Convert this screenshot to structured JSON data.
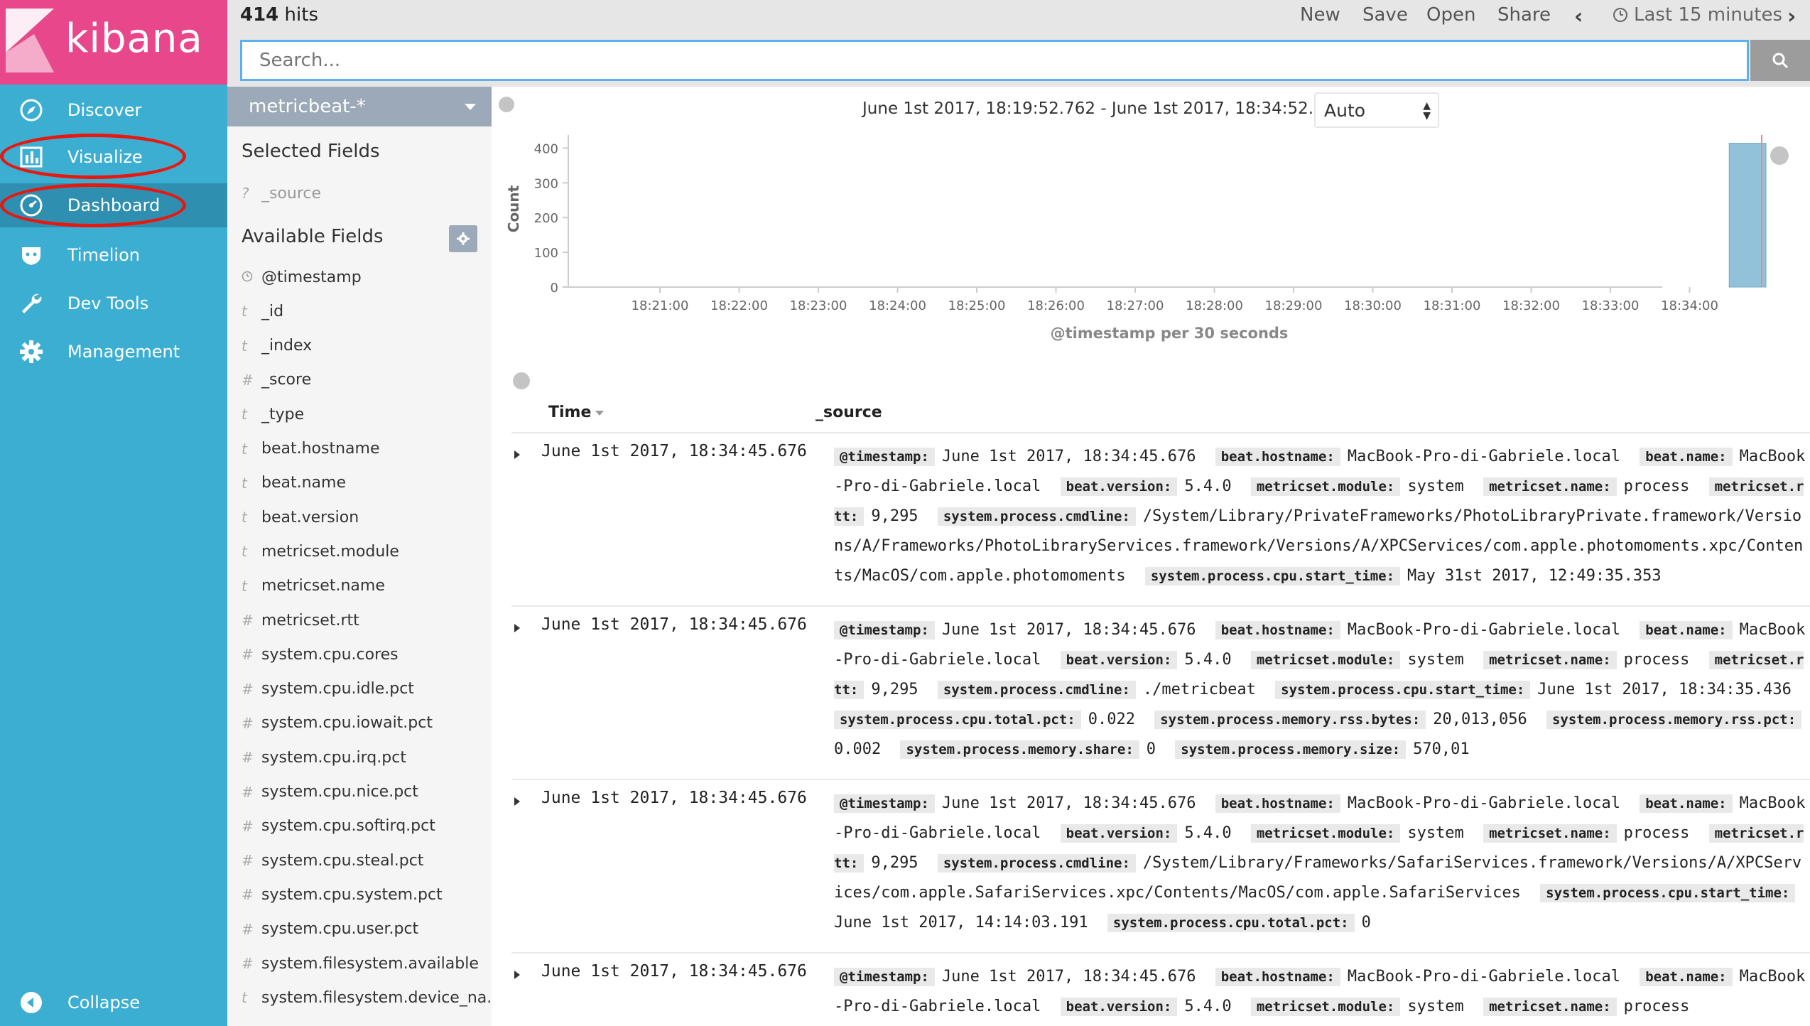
{
  "app": {
    "name": "kibana"
  },
  "nav": {
    "items": [
      {
        "label": "Discover",
        "icon": "compass-icon"
      },
      {
        "label": "Visualize",
        "icon": "bar-chart-icon"
      },
      {
        "label": "Dashboard",
        "icon": "dashboard-gauge-icon"
      },
      {
        "label": "Timelion",
        "icon": "timelion-shield-icon"
      },
      {
        "label": "Dev Tools",
        "icon": "wrench-icon"
      },
      {
        "label": "Management",
        "icon": "gear-icon"
      }
    ],
    "collapse_label": "Collapse"
  },
  "topbar": {
    "hits_count": "414",
    "hits_label": "hits",
    "new_label": "New",
    "save_label": "Save",
    "open_label": "Open",
    "share_label": "Share",
    "time_label": "Last 15 minutes"
  },
  "search": {
    "placeholder": "Search..."
  },
  "sidebar": {
    "index_pattern": "metricbeat-*",
    "selected_heading": "Selected Fields",
    "selected_fields": [
      {
        "type": "?",
        "name": "_source"
      }
    ],
    "available_heading": "Available Fields",
    "available_fields": [
      {
        "type": "clock",
        "name": "@timestamp"
      },
      {
        "type": "t",
        "name": "_id"
      },
      {
        "type": "t",
        "name": "_index"
      },
      {
        "type": "#",
        "name": "_score"
      },
      {
        "type": "t",
        "name": "_type"
      },
      {
        "type": "t",
        "name": "beat.hostname"
      },
      {
        "type": "t",
        "name": "beat.name"
      },
      {
        "type": "t",
        "name": "beat.version"
      },
      {
        "type": "t",
        "name": "metricset.module"
      },
      {
        "type": "t",
        "name": "metricset.name"
      },
      {
        "type": "#",
        "name": "metricset.rtt"
      },
      {
        "type": "#",
        "name": "system.cpu.cores"
      },
      {
        "type": "#",
        "name": "system.cpu.idle.pct"
      },
      {
        "type": "#",
        "name": "system.cpu.iowait.pct"
      },
      {
        "type": "#",
        "name": "system.cpu.irq.pct"
      },
      {
        "type": "#",
        "name": "system.cpu.nice.pct"
      },
      {
        "type": "#",
        "name": "system.cpu.softirq.pct"
      },
      {
        "type": "#",
        "name": "system.cpu.steal.pct"
      },
      {
        "type": "#",
        "name": "system.cpu.system.pct"
      },
      {
        "type": "#",
        "name": "system.cpu.user.pct"
      },
      {
        "type": "#",
        "name": "system.filesystem.available"
      },
      {
        "type": "t",
        "name": "system.filesystem.device_na..."
      }
    ]
  },
  "main": {
    "range_text": "June 1st 2017, 18:19:52.762 - June 1st 2017, 18:34:52.762 —",
    "interval": "Auto",
    "table_headers": {
      "time": "Time",
      "source": "_source"
    }
  },
  "chart_data": {
    "type": "bar",
    "ylabel": "Count",
    "xlabel": "@timestamp per 30 seconds",
    "ylim": [
      0,
      450
    ],
    "yticks": [
      0,
      100,
      200,
      300,
      400
    ],
    "xticks": [
      "18:21:00",
      "18:22:00",
      "18:23:00",
      "18:24:00",
      "18:25:00",
      "18:26:00",
      "18:27:00",
      "18:28:00",
      "18:29:00",
      "18:30:00",
      "18:31:00",
      "18:32:00",
      "18:33:00",
      "18:34:00"
    ],
    "bars": [
      {
        "x": "18:34:30",
        "value": 414
      }
    ],
    "bar_color": "#92c2d9"
  },
  "documents": [
    {
      "time": "June 1st 2017, 18:34:45.676",
      "fields": [
        {
          "key": "@timestamp:",
          "value": "June 1st 2017, 18:34:45.676"
        },
        {
          "key": "beat.hostname:",
          "value": "MacBook-Pro-di-Gabriele.local"
        },
        {
          "key": "beat.name:",
          "value": "MacBook-Pro-di-Gabriele.local"
        },
        {
          "key": "beat.version:",
          "value": "5.4.0"
        },
        {
          "key": "metricset.module:",
          "value": "system"
        },
        {
          "key": "metricset.name:",
          "value": "process"
        },
        {
          "key": "metricset.rtt:",
          "value": "9,295"
        },
        {
          "key": "system.process.cmdline:",
          "value": "/System/Library/PrivateFrameworks/PhotoLibraryPrivate.framework/Versions/A/Frameworks/PhotoLibraryServices.framework/Versions/A/XPCServices/com.apple.photomoments.xpc/Contents/MacOS/com.apple.photomoments"
        },
        {
          "key": "system.process.cpu.start_time:",
          "value": "May 31st 2017, 12:49:35.353"
        }
      ]
    },
    {
      "time": "June 1st 2017, 18:34:45.676",
      "fields": [
        {
          "key": "@timestamp:",
          "value": "June 1st 2017, 18:34:45.676"
        },
        {
          "key": "beat.hostname:",
          "value": "MacBook-Pro-di-Gabriele.local"
        },
        {
          "key": "beat.name:",
          "value": "MacBook-Pro-di-Gabriele.local"
        },
        {
          "key": "beat.version:",
          "value": "5.4.0"
        },
        {
          "key": "metricset.module:",
          "value": "system"
        },
        {
          "key": "metricset.name:",
          "value": "process"
        },
        {
          "key": "metricset.rtt:",
          "value": "9,295"
        },
        {
          "key": "system.process.cmdline:",
          "value": "./metricbeat"
        },
        {
          "key": "system.process.cpu.start_time:",
          "value": "June 1st 2017, 18:34:35.436"
        },
        {
          "key": "system.process.cpu.total.pct:",
          "value": "0.022"
        },
        {
          "key": "system.process.memory.rss.bytes:",
          "value": "20,013,056"
        },
        {
          "key": "system.process.memory.rss.pct:",
          "value": "0.002"
        },
        {
          "key": "system.process.memory.share:",
          "value": "0"
        },
        {
          "key": "system.process.memory.size:",
          "value": "570,01"
        }
      ]
    },
    {
      "time": "June 1st 2017, 18:34:45.676",
      "fields": [
        {
          "key": "@timestamp:",
          "value": "June 1st 2017, 18:34:45.676"
        },
        {
          "key": "beat.hostname:",
          "value": "MacBook-Pro-di-Gabriele.local"
        },
        {
          "key": "beat.name:",
          "value": "MacBook-Pro-di-Gabriele.local"
        },
        {
          "key": "beat.version:",
          "value": "5.4.0"
        },
        {
          "key": "metricset.module:",
          "value": "system"
        },
        {
          "key": "metricset.name:",
          "value": "process"
        },
        {
          "key": "metricset.rtt:",
          "value": "9,295"
        },
        {
          "key": "system.process.cmdline:",
          "value": "/System/Library/Frameworks/SafariServices.framework/Versions/A/XPCServices/com.apple.SafariServices.xpc/Contents/MacOS/com.apple.SafariServices"
        },
        {
          "key": "system.process.cpu.start_time:",
          "value": "June 1st 2017, 14:14:03.191"
        },
        {
          "key": "system.process.cpu.total.pct:",
          "value": "0"
        }
      ]
    },
    {
      "time": "June 1st 2017, 18:34:45.676",
      "fields": [
        {
          "key": "@timestamp:",
          "value": "June 1st 2017, 18:34:45.676"
        },
        {
          "key": "beat.hostname:",
          "value": "MacBook-Pro-di-Gabriele.local"
        },
        {
          "key": "beat.name:",
          "value": "MacBook-Pro-di-Gabriele.local"
        },
        {
          "key": "beat.version:",
          "value": "5.4.0"
        },
        {
          "key": "metricset.module:",
          "value": "system"
        },
        {
          "key": "metricset.name:",
          "value": "process"
        }
      ]
    }
  ],
  "colors": {
    "nav_bg": "#3caed2",
    "logo_bg": "#e8488b",
    "highlight_ring": "#e7180f",
    "search_border": "#5ab1ec"
  }
}
